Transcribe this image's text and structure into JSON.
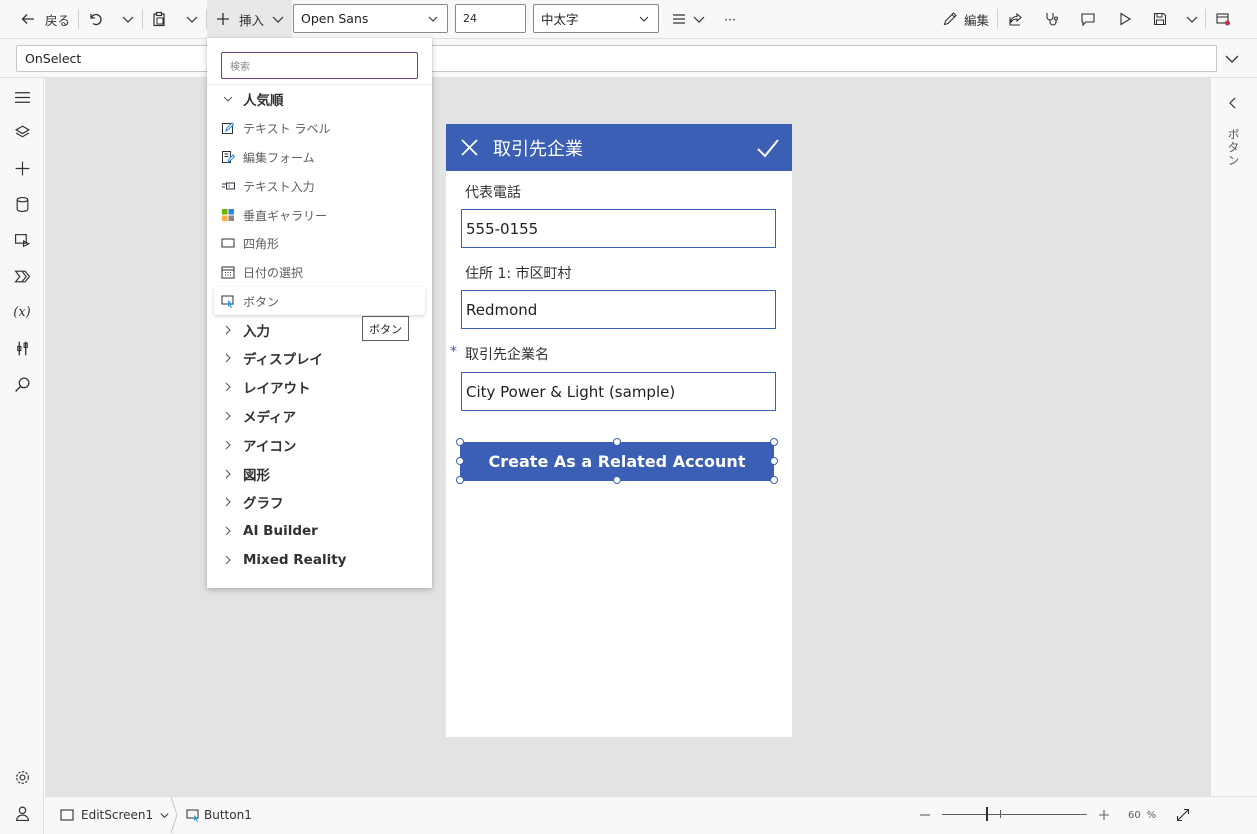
{
  "toolbar": {
    "back_label": "戻る",
    "insert_label": "挿入",
    "font_family": "Open Sans",
    "font_size": "24",
    "font_weight": "中太字",
    "more_label": "···",
    "edit_label": "編集"
  },
  "formula": {
    "property": "OnSelect",
    "expression": ""
  },
  "insert_menu": {
    "search_placeholder": "検索",
    "popular_label": "人気順",
    "items": [
      {
        "label": "テキスト ラベル",
        "icon": "text-label-icon"
      },
      {
        "label": "編集フォーム",
        "icon": "edit-form-icon"
      },
      {
        "label": "テキスト入力",
        "icon": "text-input-icon"
      },
      {
        "label": "垂直ギャラリー",
        "icon": "vertical-gallery-icon"
      },
      {
        "label": "四角形",
        "icon": "rectangle-icon"
      },
      {
        "label": "日付の選択",
        "icon": "date-picker-icon"
      },
      {
        "label": "ボタン",
        "icon": "button-icon"
      }
    ],
    "categories": [
      "入力",
      "ディスプレイ",
      "レイアウト",
      "メディア",
      "アイコン",
      "図形",
      "グラフ",
      "AI Builder",
      "Mixed Reality"
    ],
    "tooltip": "ボタン"
  },
  "form": {
    "title": "取引先企業",
    "fields": [
      {
        "label": "代表電話",
        "value": "555-0155",
        "required": false
      },
      {
        "label": "住所 1: 市区町村",
        "value": "Redmond",
        "required": false
      },
      {
        "label": "取引先企業名",
        "value": "City Power & Light (sample)",
        "required": true
      }
    ],
    "required_marker": "*",
    "button_label": "Create As a Related Account"
  },
  "right_panel": {
    "label": "ボタン"
  },
  "status": {
    "screen_name": "EditScreen1",
    "control_name": "Button1",
    "zoom_value": "60",
    "zoom_unit": "%"
  },
  "colors": {
    "accent": "#3a5fb5",
    "search_border": "#6b3d8a"
  }
}
